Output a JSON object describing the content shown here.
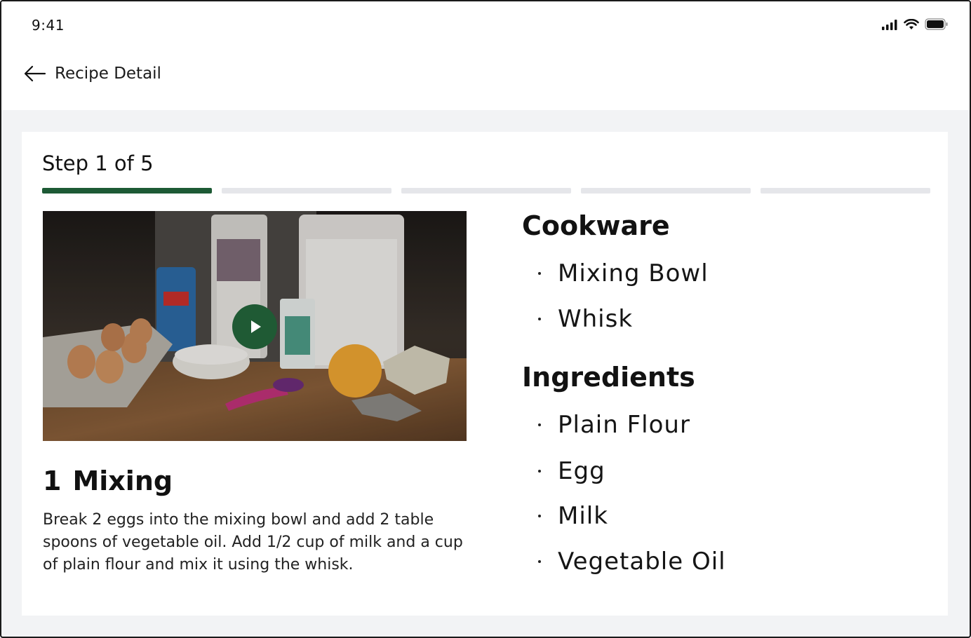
{
  "status_bar": {
    "time": "9:41",
    "icons": [
      "cellular-signal-icon",
      "wifi-icon",
      "battery-icon"
    ]
  },
  "header": {
    "back_icon": "arrow-left-icon",
    "title": "Recipe Detail"
  },
  "step": {
    "label": "Step 1 of 5",
    "current": 1,
    "total": 5,
    "number": "1",
    "title": "Mixing",
    "description": "Break 2 eggs into the mixing bowl and add 2 table spoons of vegetable oil. Add 1/2 cup of milk and a cup of plain flour and mix it using the whisk."
  },
  "media": {
    "play_icon": "play-icon"
  },
  "cookware": {
    "title": "Cookware",
    "items": [
      "Mixing Bowl",
      "Whisk"
    ]
  },
  "ingredients": {
    "title": "Ingredients",
    "items": [
      "Plain Flour",
      "Egg",
      "Milk",
      "Vegetable Oil"
    ]
  },
  "colors": {
    "accent": "#1d5a35",
    "progress_inactive": "#e5e6ea",
    "background": "#f2f3f5"
  }
}
